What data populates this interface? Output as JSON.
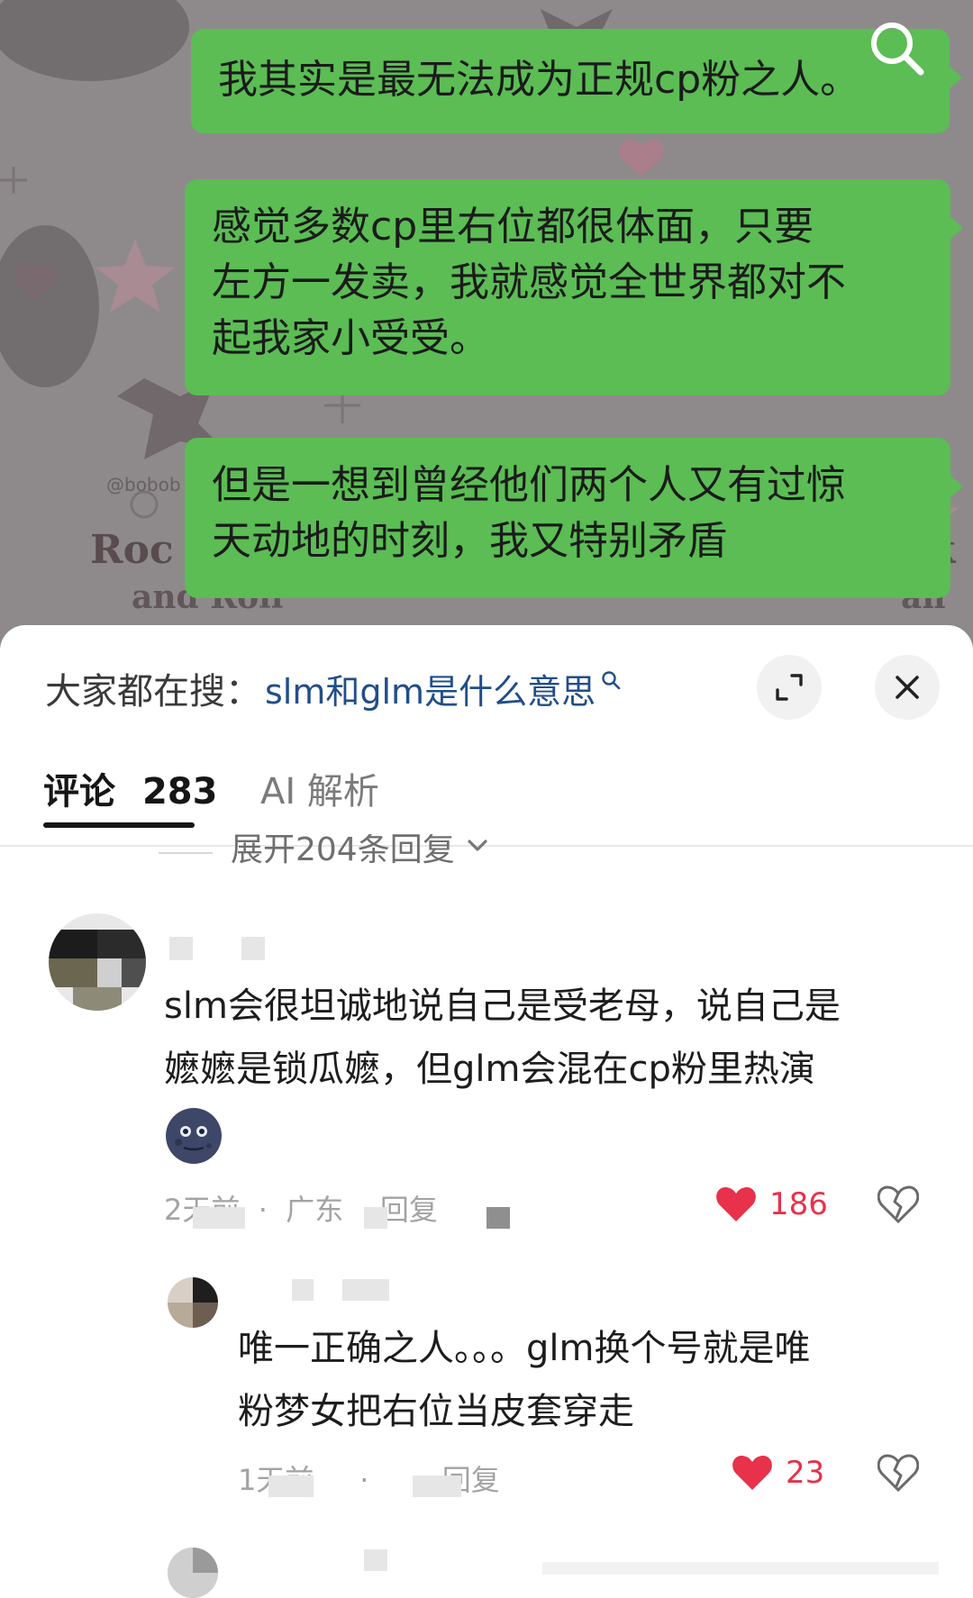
{
  "chat": {
    "messages": [
      "我其实是最无法成为正规cp粉之人。",
      "感觉多数cp里右位都很体面，只要\n左方一发卖，我就感觉全世界都对不\n起我家小受受。",
      "但是一想到曾经他们两个人又有过惊\n天动地的时刻，我又特别矛盾"
    ],
    "watermark": "@bobob",
    "art_text_1": "Roc",
    "art_text_2": "and Roll",
    "art_text_right": "k",
    "art_text_right_2": "an"
  },
  "comments_panel": {
    "hot_search_prefix": "大家都在搜：",
    "hot_search_link": "slm和glm是什么意思",
    "tab_comments": "评论",
    "tab_comments_count": "283",
    "tab_ai": "AI 解析",
    "expand_replies": "展开204条回复",
    "comments": [
      {
        "text": "slm会很坦诚地说自己是受老母，说自己是\n嬷嬷是锁瓜嬷，但glm会混在cp粉里热演",
        "meta": "2天前  ·  广东    回复",
        "likes": "186"
      },
      {
        "text": "唯一正确之人。。。glm换个号就是唯\n粉梦女把右位当皮套穿走",
        "meta": "1天前     ·        回复",
        "likes": "23"
      }
    ]
  },
  "colors": {
    "bubble_green": "#5bbd54",
    "link_blue": "#214e8a",
    "like_red": "#e8314a"
  },
  "icons": [
    "search-icon",
    "expand-icon",
    "close-icon",
    "chevron-down-icon",
    "heart-icon",
    "broken-heart-icon",
    "moon-emoji"
  ]
}
